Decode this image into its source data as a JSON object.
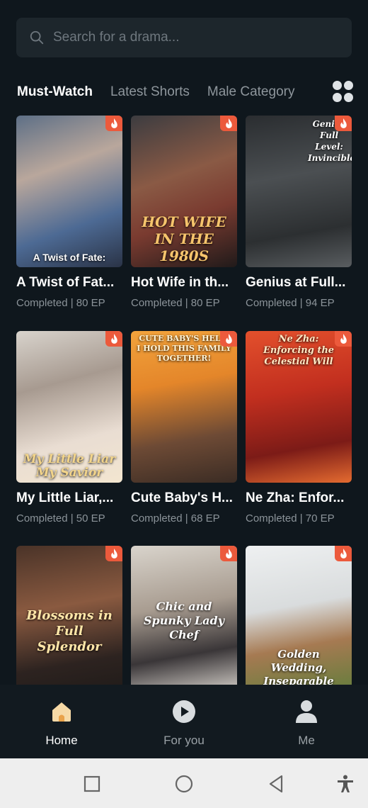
{
  "search": {
    "placeholder": "Search for a drama..."
  },
  "tabs": [
    {
      "label": "Must-Watch",
      "active": true
    },
    {
      "label": "Latest Shorts",
      "active": false
    },
    {
      "label": "Male Category",
      "active": false
    }
  ],
  "cards": [
    {
      "title": "A Twist of Fat...",
      "meta": "Completed | 80 EP",
      "poster_text": "A Twist of Fate:"
    },
    {
      "title": "Hot Wife in th...",
      "meta": "Completed | 80 EP",
      "poster_text": "HOT WIFE IN THE 1980S"
    },
    {
      "title": "Genius at Full...",
      "meta": "Completed | 94 EP",
      "poster_text": "Genius Full Level: Invincible"
    },
    {
      "title": "My Little Liar,...",
      "meta": "Completed | 50 EP",
      "poster_text": "My Little Liar My Savior"
    },
    {
      "title": "Cute Baby's H...",
      "meta": "Completed | 68 EP",
      "poster_text": "CUTE BABY'S HELP: I HOLD THIS FAMILY TOGETHER!"
    },
    {
      "title": "Ne Zha: Enfor...",
      "meta": "Completed | 70 EP",
      "poster_text": "Ne Zha: Enforcing the Celestial Will"
    },
    {
      "title": "",
      "meta": "",
      "poster_text": "Blossoms in Full Splendor"
    },
    {
      "title": "",
      "meta": "",
      "poster_text": "Chic and Spunky Lady Chef"
    },
    {
      "title": "",
      "meta": "",
      "poster_text": "Golden Wedding, Inseparable"
    }
  ],
  "bottom_nav": {
    "home": "Home",
    "for_you": "For you",
    "me": "Me"
  },
  "colors": {
    "background": "#0f171d",
    "accent": "#f3c07a",
    "badge": "#ec5a3c"
  }
}
